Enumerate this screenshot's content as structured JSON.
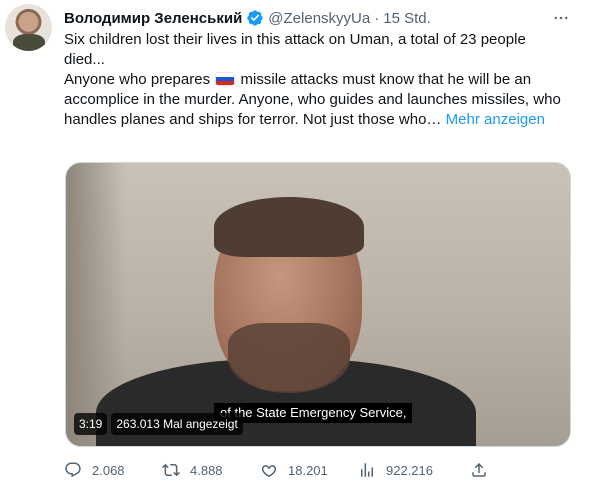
{
  "author": {
    "name": "Володимир Зеленський",
    "handle": "@ZelenskyyUa",
    "separator": "·",
    "time": "15 Std."
  },
  "icons": {
    "verified": "verified-badge-icon",
    "more": "more-options-icon",
    "reply": "reply-icon",
    "retweet": "retweet-icon",
    "like": "heart-icon",
    "views": "views-icon",
    "share": "share-icon",
    "flag": "russia-flag-icon"
  },
  "colors": {
    "verified": "#1d9bf0",
    "link": "#1d9bf0",
    "secondary": "#536471"
  },
  "tweet": {
    "line1": "Six children lost their lives in this attack on Uman, a total of 23 people died...",
    "line2_before_flag": "Anyone who prepares",
    "line2_after_flag": "missile attacks must know that he will be an accomplice in the murder. Anyone, who guides and launches missiles, who handles planes and ships for terror. Not just those who…",
    "show_more": "Mehr anzeigen"
  },
  "video": {
    "subtitle": "of the State Emergency Service,",
    "duration": "3:19",
    "views_label": "263.013 Mal angezeigt"
  },
  "actions": {
    "replies": "2.068",
    "retweets": "4.888",
    "likes": "18.201",
    "views": "922.216"
  }
}
